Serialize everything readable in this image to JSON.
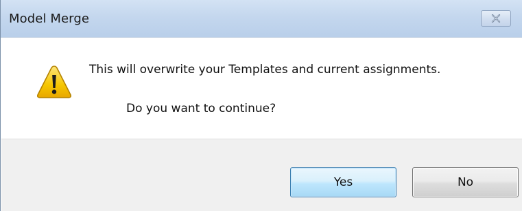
{
  "window": {
    "title": "Model Merge"
  },
  "message": {
    "icon": "warning-icon",
    "text": "This will overwrite your Templates and current assignments.",
    "question": "Do you want to continue?"
  },
  "buttons": {
    "yes_label": "Yes",
    "no_label": "No"
  },
  "colors": {
    "titlebar": "#c4d7ee",
    "button_bar": "#f0f0f0",
    "default_button_border": "#3c7fb1",
    "warning_yellow": "#f5c400"
  }
}
